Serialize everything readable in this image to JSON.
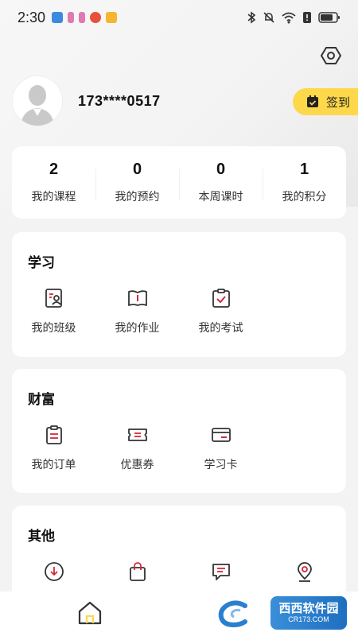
{
  "status_bar": {
    "time": "2:30"
  },
  "profile": {
    "phone": "173****0517",
    "checkin_label": "签到"
  },
  "stats": [
    {
      "value": "2",
      "label": "我的课程"
    },
    {
      "value": "0",
      "label": "我的预约"
    },
    {
      "value": "0",
      "label": "本周课时"
    },
    {
      "value": "1",
      "label": "我的积分"
    }
  ],
  "learning": {
    "title": "学习",
    "items": [
      {
        "label": "我的班级",
        "icon": "class-icon"
      },
      {
        "label": "我的作业",
        "icon": "homework-icon"
      },
      {
        "label": "我的考试",
        "icon": "exam-icon"
      }
    ]
  },
  "wealth": {
    "title": "财富",
    "items": [
      {
        "label": "我的订单",
        "icon": "order-icon"
      },
      {
        "label": "优惠券",
        "icon": "coupon-icon"
      },
      {
        "label": "学习卡",
        "icon": "study-card-icon"
      }
    ]
  },
  "other": {
    "title": "其他",
    "items": [
      {
        "icon": "download-icon"
      },
      {
        "icon": "shopping-bag-icon"
      },
      {
        "icon": "message-icon"
      },
      {
        "icon": "location-icon"
      }
    ]
  },
  "watermark": {
    "cn": "西西软件园",
    "en": "CR173.COM"
  },
  "colors": {
    "accent": "#fcd84a",
    "icon_red": "#d4283a",
    "icon_dark": "#333333"
  }
}
